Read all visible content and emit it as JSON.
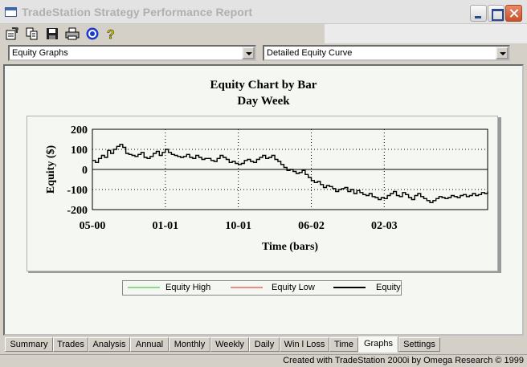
{
  "window": {
    "title": "TradeStation Strategy Performance Report"
  },
  "toolbar": {
    "icons": [
      "properties-icon",
      "copy-icon",
      "save-icon",
      "print-icon",
      "target-icon",
      "help-icon"
    ]
  },
  "selectors": {
    "report_type": "Equity Graphs",
    "curve_type": "Detailed Equity Curve"
  },
  "chart_data": {
    "type": "line",
    "title": "Equity Chart by Bar",
    "subtitle": "Day Week",
    "xlabel": "Time (bars)",
    "ylabel": "Equity ($)",
    "ylim": [
      -200,
      200
    ],
    "yticks": [
      200,
      100,
      0,
      -100,
      -200
    ],
    "xticks": [
      "05-00",
      "01-01",
      "10-01",
      "06-02",
      "02-03"
    ],
    "xrange": [
      0,
      130
    ],
    "xtick_positions": [
      0,
      24,
      48,
      72,
      96
    ],
    "grid": "dotted",
    "series": [
      {
        "name": "Equity High",
        "color": "#22bb22",
        "values": []
      },
      {
        "name": "Equity Low",
        "color": "#dd2222",
        "values": []
      },
      {
        "name": "Equity",
        "color": "#000000",
        "values": [
          45,
          35,
          55,
          70,
          60,
          95,
          80,
          100,
          115,
          125,
          110,
          80,
          75,
          70,
          65,
          75,
          85,
          60,
          55,
          65,
          80,
          90,
          70,
          85,
          100,
          85,
          75,
          70,
          65,
          60,
          65,
          75,
          60,
          55,
          70,
          60,
          50,
          55,
          55,
          45,
          40,
          55,
          70,
          60,
          50,
          35,
          40,
          30,
          25,
          30,
          45,
          50,
          40,
          35,
          50,
          60,
          70,
          55,
          60,
          70,
          50,
          40,
          25,
          10,
          -5,
          0,
          -10,
          -20,
          -15,
          -5,
          -25,
          -40,
          -55,
          -65,
          -60,
          -75,
          -90,
          -80,
          -85,
          -95,
          -110,
          -100,
          -95,
          -90,
          -110,
          -100,
          -120,
          -105,
          -115,
          -125,
          -130,
          -120,
          -135,
          -140,
          -150,
          -140,
          -145,
          -130,
          -120,
          -110,
          -130,
          -135,
          -115,
          -125,
          -140,
          -150,
          -130,
          -120,
          -135,
          -145,
          -155,
          -165,
          -155,
          -145,
          -135,
          -140,
          -145,
          -140,
          -130,
          -135,
          -140,
          -130,
          -125,
          -135,
          -130,
          -120,
          -130,
          -125,
          -115,
          -120,
          -110
        ]
      }
    ],
    "legend_position": "bottom"
  },
  "tabs": [
    "Summary",
    "Trades",
    "Analysis",
    "Annual",
    "Monthly",
    "Weekly",
    "Daily",
    "Win l Loss",
    "Time",
    "Graphs",
    "Settings"
  ],
  "active_tab": "Graphs",
  "status": {
    "text": "Created with TradeStation 2000i by Omega Research © 1999"
  }
}
